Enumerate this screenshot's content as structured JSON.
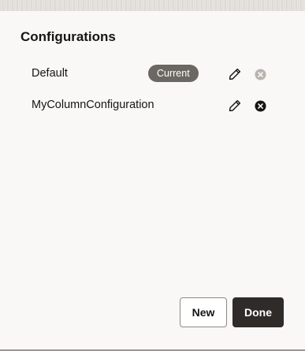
{
  "dialog": {
    "title": "Configurations",
    "configurations": [
      {
        "name": "Default",
        "badge": "Current",
        "edit_icon": "pencil-icon",
        "delete_icon": "close-circle-icon",
        "delete_enabled": false
      },
      {
        "name": "MyColumnConfiguration",
        "badge": "",
        "edit_icon": "pencil-icon",
        "delete_icon": "close-circle-icon",
        "delete_enabled": true
      }
    ],
    "buttons": {
      "new_label": "New",
      "done_label": "Done"
    }
  },
  "colors": {
    "badge_bg": "#6b6762",
    "primary_button": "#2e2b29",
    "disabled_icon": "#b8b5b0"
  }
}
